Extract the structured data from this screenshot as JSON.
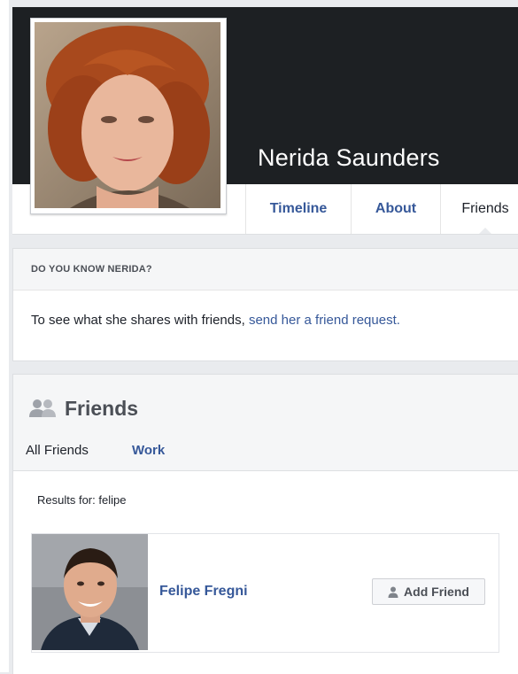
{
  "profile": {
    "name": "Nerida Saunders"
  },
  "nav": {
    "tabs": [
      {
        "label": "Timeline"
      },
      {
        "label": "About"
      },
      {
        "label": "Friends"
      }
    ]
  },
  "know_card": {
    "heading": "DO YOU KNOW NERIDA?",
    "message_prefix": "To see what she shares with friends, ",
    "message_link": "send her a friend request."
  },
  "friends": {
    "title": "Friends",
    "tabs": {
      "all": "All Friends",
      "work": "Work"
    },
    "results_label": "Results for: felipe",
    "items": [
      {
        "name": "Felipe Fregni",
        "button_label": "Add Friend"
      }
    ]
  },
  "colors": {
    "link": "#365899",
    "cover": "#1d2023",
    "page_bg": "#e9ebee"
  }
}
